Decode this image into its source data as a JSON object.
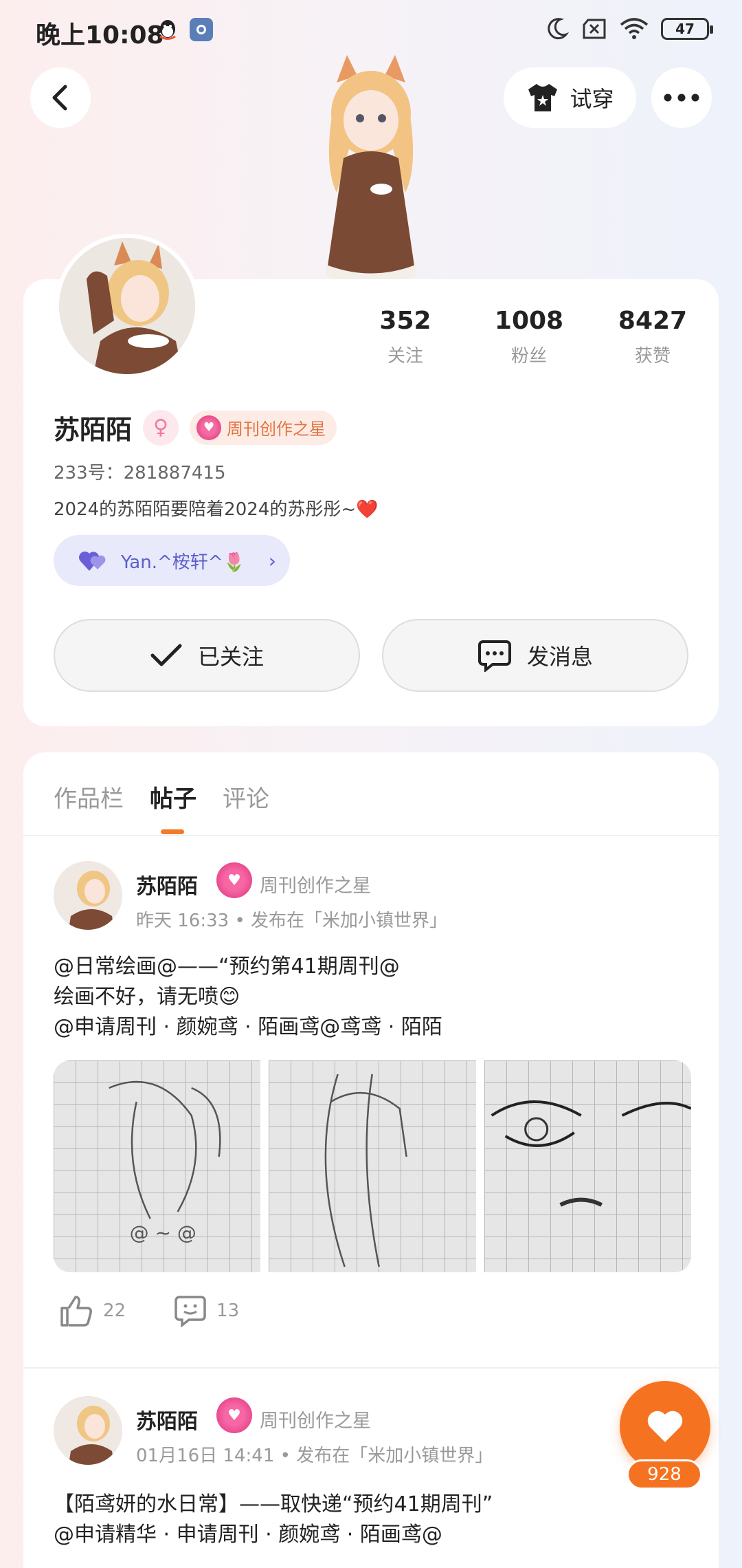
{
  "status_bar": {
    "time": "晚上10:08",
    "battery": "47"
  },
  "header": {
    "try_on_label": "试穿"
  },
  "profile": {
    "stats": [
      {
        "value": "352",
        "label": "关注"
      },
      {
        "value": "1008",
        "label": "粉丝"
      },
      {
        "value": "8427",
        "label": "获赞"
      }
    ],
    "name": "苏陌陌",
    "gender_symbol": "♀",
    "badge": "周刊创作之星",
    "uid": "233号：281887415",
    "bio": "2024的苏陌陌要陪着2024的苏彤彤~❤️",
    "fan_pill": "Yan.^桉轩^🌷",
    "follow_label": "已关注",
    "message_label": "发消息"
  },
  "tabs": [
    "作品栏",
    "帖子",
    "评论"
  ],
  "active_tab": "帖子",
  "posts": [
    {
      "author": "苏陌陌",
      "badge": "周刊创作之星",
      "meta": "昨天 16:33 • 发布在「米加小镇世界」",
      "lines": [
        "@日常绘画@——“预约第41期周刊@",
        "绘画不好，请无喷😊",
        "@申请周刊 · 颜婉鸢 · 陌画鸢@鸢鸢 · 陌陌"
      ],
      "likes": "22",
      "comments": "13"
    },
    {
      "author": "苏陌陌",
      "badge": "周刊创作之星",
      "meta": "01月16日 14:41 • 发布在「米加小镇世界」",
      "lines": [
        "【陌鸢妍的水日常】——取快递“预约41期周刊”",
        "@申请精华 · 申请周刊 · 颜婉鸢 · 陌画鸢@"
      ]
    }
  ],
  "like_fab": {
    "count": "928"
  },
  "colors": {
    "accent": "#f57221",
    "fan_pill_bg": "#e8e9fb",
    "badge_pink": "#e0307c"
  }
}
